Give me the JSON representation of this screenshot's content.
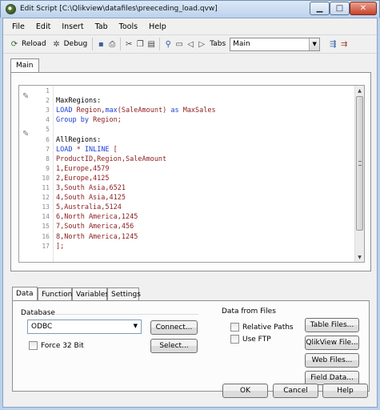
{
  "window": {
    "title": "Edit Script [C:\\Qlikview\\datafiles\\preeceding_load.qvw]"
  },
  "menu": [
    "File",
    "Edit",
    "Insert",
    "Tab",
    "Tools",
    "Help"
  ],
  "toolbar": {
    "reload_label": "Reload",
    "debug_label": "Debug",
    "tabs_label": "Tabs",
    "tabs_value": "Main"
  },
  "editor": {
    "tab_label": "Main",
    "lines": [
      {
        "n": "1",
        "text": ""
      },
      {
        "n": "2",
        "text": "MaxRegions:"
      },
      {
        "n": "3",
        "text": "LOAD Region,max(SaleAmount) as MaxSales"
      },
      {
        "n": "4",
        "text": "Group by Region;"
      },
      {
        "n": "5",
        "text": ""
      },
      {
        "n": "6",
        "text": "AllRegions:"
      },
      {
        "n": "7",
        "text": "LOAD * INLINE ["
      },
      {
        "n": "8",
        "text": "ProductID,Region,SaleAmount"
      },
      {
        "n": "9",
        "text": "1,Europe,4579"
      },
      {
        "n": "10",
        "text": "2,Europe,4125"
      },
      {
        "n": "11",
        "text": "3,South Asia,6521"
      },
      {
        "n": "12",
        "text": "4,South Asia,4125"
      },
      {
        "n": "13",
        "text": "5,Australia,5124"
      },
      {
        "n": "14",
        "text": "6,North America,1245"
      },
      {
        "n": "15",
        "text": "7,South America,456"
      },
      {
        "n": "16",
        "text": "8,North America,1245"
      },
      {
        "n": "17",
        "text": "];"
      }
    ]
  },
  "bottom_tabs": [
    "Data",
    "Functions",
    "Variables",
    "Settings"
  ],
  "data_panel": {
    "database_label": "Database",
    "database_value": "ODBC",
    "connect_label": "Connect...",
    "select_label": "Select...",
    "force32_label": "Force 32 Bit",
    "from_files_label": "Data from Files",
    "relative_paths_label": "Relative Paths",
    "use_ftp_label": "Use FTP",
    "table_files_label": "Table Files...",
    "qlikview_file_label": "QlikView File...",
    "web_files_label": "Web Files...",
    "field_data_label": "Field Data..."
  },
  "footer": {
    "ok_label": "OK",
    "cancel_label": "Cancel",
    "help_label": "Help"
  }
}
